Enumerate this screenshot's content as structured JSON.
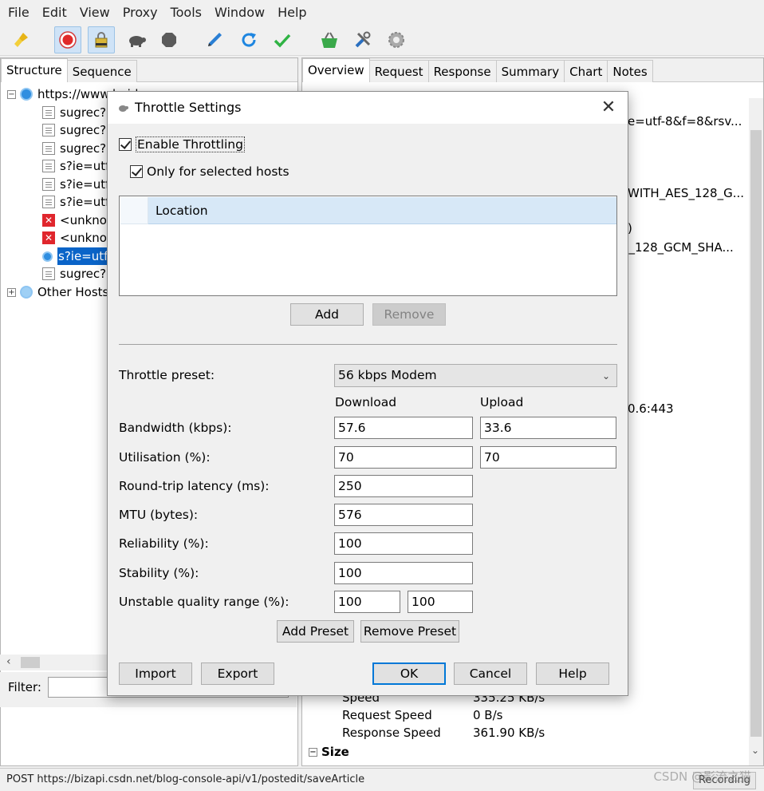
{
  "menu": [
    "File",
    "Edit",
    "View",
    "Proxy",
    "Tools",
    "Window",
    "Help"
  ],
  "toolbar": {
    "buttons": [
      "broom-icon",
      "record-icon",
      "ssl-lock-icon",
      "turtle-icon",
      "stop-icon",
      "pen-icon",
      "refresh-icon",
      "check-icon",
      "basket-icon",
      "tools-icon",
      "gear-icon"
    ]
  },
  "left": {
    "tabs": [
      "Structure",
      "Sequence"
    ],
    "tree": [
      {
        "label": "https://www.baidu.com",
        "icon": "globe-icon",
        "level": 0
      },
      {
        "label": "sugrec?p",
        "icon": "document-icon",
        "level": 1
      },
      {
        "label": "sugrec?p",
        "icon": "document-icon",
        "level": 1
      },
      {
        "label": "sugrec?p",
        "icon": "document-icon",
        "level": 1
      },
      {
        "label": "s?ie=utf",
        "icon": "document-icon",
        "level": 1
      },
      {
        "label": "s?ie=utf",
        "icon": "document-icon",
        "level": 1
      },
      {
        "label": "s?ie=utf",
        "icon": "document-icon",
        "level": 1
      },
      {
        "label": "<unknow",
        "icon": "error-icon",
        "level": 1
      },
      {
        "label": "<unknow",
        "icon": "error-icon",
        "level": 1
      },
      {
        "label": "s?ie=utf",
        "icon": "document-icon",
        "level": 1,
        "selected": true
      },
      {
        "label": "sugrec?p",
        "icon": "document-icon",
        "level": 1
      },
      {
        "label": "Other Hosts",
        "icon": "network-icon",
        "level": 0
      }
    ],
    "filter_label": "Filter:"
  },
  "right": {
    "tabs": [
      "Overview",
      "Request",
      "Response",
      "Summary",
      "Chart",
      "Notes"
    ],
    "fragments": [
      "e=utf-8&f=8&rsv...",
      "WITH_AES_128_G...",
      ")",
      "S_128_GCM_SHA...",
      "0.6:443"
    ],
    "speed": {
      "speed_label": "Speed",
      "speed_value": "335.25 KB/s",
      "request_label": "Request Speed",
      "request_value": "0 B/s",
      "response_label": "Response Speed",
      "response_value": "361.90 KB/s"
    },
    "size_label": "Size"
  },
  "status": {
    "text": "POST https://bizapi.csdn.net/blog-console-api/v1/postedit/saveArticle",
    "recording": "Recording",
    "watermark": "CSDN @影流之猫"
  },
  "dialog": {
    "title": "Throttle Settings",
    "enable_throttling": "Enable Throttling",
    "only_selected_hosts": "Only for selected hosts",
    "location_header": "Location",
    "add": "Add",
    "remove": "Remove",
    "preset_label": "Throttle preset:",
    "preset_value": "56 kbps Modem",
    "download_header": "Download",
    "upload_header": "Upload",
    "bandwidth_label": "Bandwidth (kbps):",
    "bandwidth_down": "57.6",
    "bandwidth_up": "33.6",
    "utilisation_label": "Utilisation (%):",
    "utilisation_down": "70",
    "utilisation_up": "70",
    "latency_label": "Round-trip latency (ms):",
    "latency": "250",
    "mtu_label": "MTU (bytes):",
    "mtu": "576",
    "reliability_label": "Reliability (%):",
    "reliability": "100",
    "stability_label": "Stability (%):",
    "stability": "100",
    "unstable_label": "Unstable quality range (%):",
    "unstable_low": "100",
    "unstable_high": "100",
    "add_preset": "Add Preset",
    "remove_preset": "Remove Preset",
    "import": "Import",
    "export": "Export",
    "ok": "OK",
    "cancel": "Cancel",
    "help": "Help"
  }
}
